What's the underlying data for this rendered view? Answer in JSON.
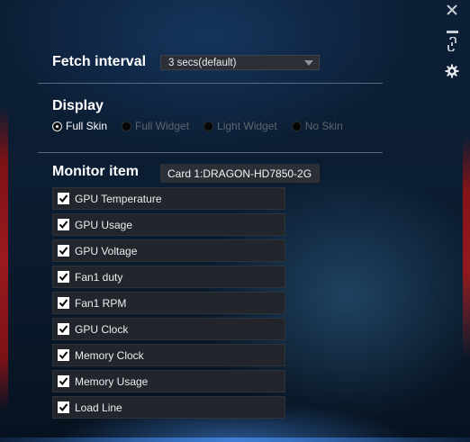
{
  "window_controls": {
    "close_icon": "close-icon",
    "minimize_icon": "minimize-icon",
    "link_icon": "link-icon",
    "settings_icon": "gear-icon"
  },
  "fetch": {
    "label": "Fetch interval",
    "value": "3 secs(default)"
  },
  "display": {
    "label": "Display",
    "options": [
      {
        "label": "Full Skin",
        "selected": true
      },
      {
        "label": "Full Widget",
        "selected": false
      },
      {
        "label": "Light Widget",
        "selected": false
      },
      {
        "label": "No Skin",
        "selected": false
      }
    ]
  },
  "monitor": {
    "label": "Monitor item",
    "card": "Card 1:DRAGON-HD7850-2G",
    "items": [
      {
        "label": "GPU Temperature",
        "checked": true
      },
      {
        "label": "GPU Usage",
        "checked": true
      },
      {
        "label": "GPU Voltage",
        "checked": true
      },
      {
        "label": "Fan1 duty",
        "checked": true
      },
      {
        "label": "Fan1 RPM",
        "checked": true
      },
      {
        "label": "GPU Clock",
        "checked": true
      },
      {
        "label": "Memory Clock",
        "checked": true
      },
      {
        "label": "Memory Usage",
        "checked": true
      },
      {
        "label": "Load Line",
        "checked": true
      }
    ]
  },
  "colors": {
    "background": "#0b1c30",
    "accent_red": "#9a1a1f",
    "control_bg": "#2c2f35"
  }
}
